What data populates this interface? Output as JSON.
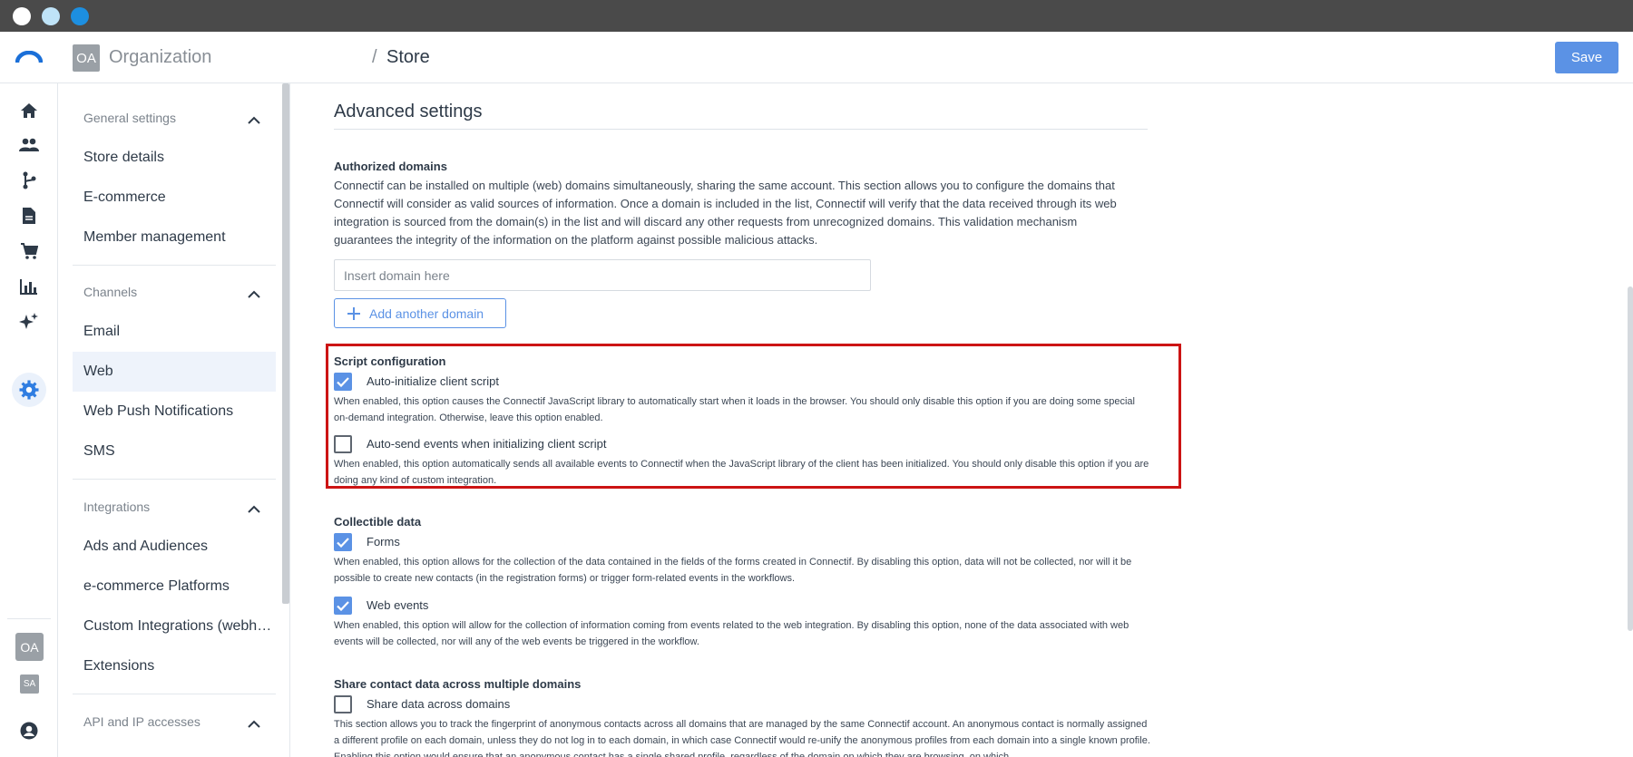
{
  "header": {
    "org_badge": "OA",
    "org_name": "Organization",
    "separator": "/",
    "store": "Store",
    "save_label": "Save"
  },
  "rail": {
    "icons": [
      "home-icon",
      "contacts-icon",
      "workflow-icon",
      "document-icon",
      "cart-icon",
      "chart-icon",
      "sparkle-icon",
      "settings-icon",
      "user-icon"
    ],
    "org_badge": "OA",
    "user_badge": "SA"
  },
  "sidebar": {
    "sections": [
      {
        "title": "General settings",
        "items": [
          "Store details",
          "E-commerce",
          "Member management"
        ]
      },
      {
        "title": "Channels",
        "items": [
          "Email",
          "Web",
          "Web Push Notifications",
          "SMS"
        ]
      },
      {
        "title": "Integrations",
        "items": [
          "Ads and Audiences",
          "e-commerce Platforms",
          "Custom Integrations (webh…",
          "Extensions"
        ]
      },
      {
        "title": "API and IP accesses",
        "items": []
      }
    ],
    "active_item": "Web"
  },
  "main": {
    "title": "Advanced settings",
    "authorized_domains": {
      "label": "Authorized domains",
      "description": "Connectif can be installed on multiple (web) domains simultaneously, sharing the same account. This section allows you to configure the domains that Connectif will consider as valid sources of information. Once a domain is included in the list, Connectif will verify that the data received through its web integration is sourced from the domain(s) in the list and will discard any other requests from unrecognized domains. This validation mechanism guarantees the integrity of the information on the platform against possible malicious attacks.",
      "input_placeholder": "Insert domain here",
      "add_button": "Add another domain"
    },
    "script_config": {
      "label": "Script configuration",
      "auto_init": {
        "checked": true,
        "label": "Auto-initialize client script",
        "description": "When enabled, this option causes the Connectif JavaScript library to automatically start when it loads in the browser. You should only disable this option if you are doing some special on-demand integration. Otherwise, leave this option enabled."
      },
      "auto_send": {
        "checked": false,
        "label": "Auto-send events when initializing client script",
        "description": "When enabled, this option automatically sends all available events to Connectif when the JavaScript library of the client has been initialized. You should only disable this option if you are doing any kind of custom integration."
      }
    },
    "collectible_data": {
      "label": "Collectible data",
      "forms": {
        "checked": true,
        "label": "Forms",
        "description": "When enabled, this option allows for the collection of the data contained in the fields of the forms created in Connectif. By disabling this option, data will not be collected, nor will it be possible to create new contacts (in the registration forms) or trigger form-related events in the workflows."
      },
      "web_events": {
        "checked": true,
        "label": "Web events",
        "description": "When enabled, this option will allow for the collection of information coming from events related to the web integration. By disabling this option, none of the data associated with web events will be collected, nor will any of the web events be triggered in the workflow."
      }
    },
    "share_contact": {
      "label": "Share contact data across multiple domains",
      "share": {
        "checked": false,
        "label": "Share data across domains",
        "description": "This section allows you to track the fingerprint of anonymous contacts across all domains that are managed by the same Connectif account. An anonymous contact is normally assigned a different profile on each domain, unless they do not log in to each domain, in which case Connectif would re-unify the anonymous profiles from each domain into a single known profile. Enabling this option would ensure that an anonymous contact has a single shared profile, regardless of the domain on which they are browsing, on which"
      }
    }
  },
  "colors": {
    "accent": "#5b92e5",
    "highlight": "#cc1414"
  }
}
